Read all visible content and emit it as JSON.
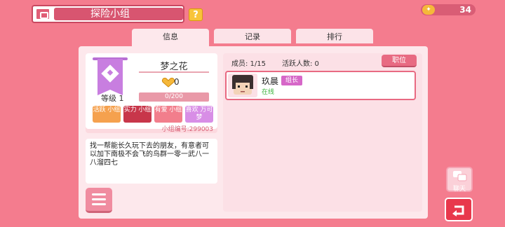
{
  "header": {
    "title": "探险小组",
    "help_label": "?",
    "coins": "34"
  },
  "tabs": [
    {
      "label": "信息",
      "active": true
    },
    {
      "label": "记录",
      "active": false
    },
    {
      "label": "排行",
      "active": false
    }
  ],
  "group": {
    "name": "梦之花",
    "hearts": "0",
    "level": "等级 1",
    "xp": "0/200",
    "tags": [
      {
        "label": "活跃 小组",
        "color": "#f5a14e"
      },
      {
        "label": "实力 小组",
        "color": "#c8364a"
      },
      {
        "label": "有爱 小组",
        "color": "#f27e8c"
      },
      {
        "label": "喜欢 万可梦",
        "color": "#d88ee6"
      }
    ],
    "id_text": "小组编号:299003",
    "description": "找一帮能长久玩下去的朋友，有意者可以加下南极不会飞的鸟群一零一武八一八溜四七"
  },
  "members": {
    "count_label": "成员: 1/15",
    "active_label": "活跃人数: 0",
    "role_button": "职位",
    "list": [
      {
        "name": "玖晨",
        "badge": "组长",
        "status": "在线"
      }
    ]
  },
  "side": {
    "chat_label": "聊天"
  },
  "colors": {
    "background": "#f47c8e",
    "accent": "#e86a82"
  }
}
